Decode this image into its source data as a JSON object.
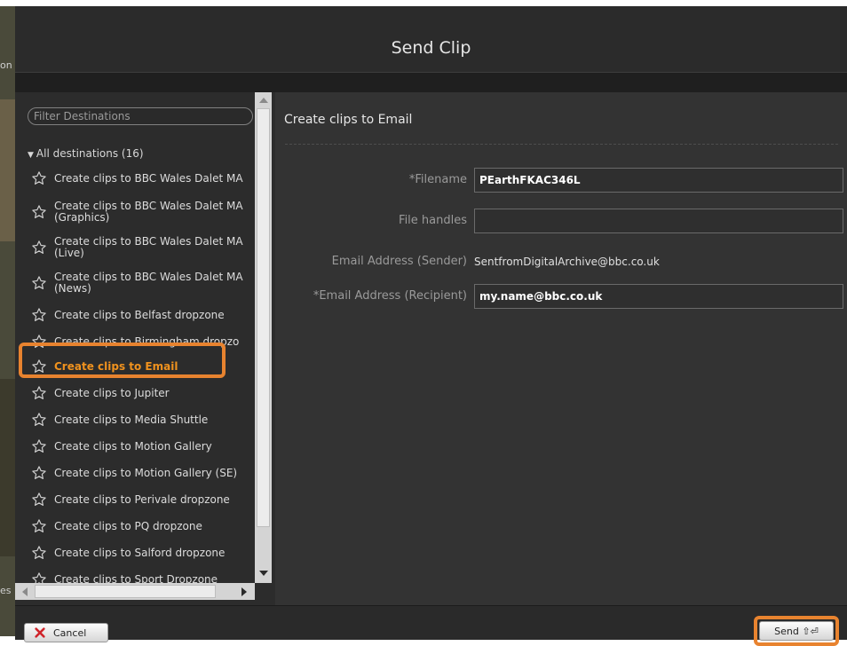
{
  "background": {
    "text_top": "on",
    "text_bottom": "es"
  },
  "dialog": {
    "title": "Send Clip"
  },
  "left_panel": {
    "filter_placeholder": "Filter Destinations",
    "tree_header": "All destinations (16)",
    "items": [
      {
        "label": "Create clips to BBC Wales Dalet MA",
        "selected": false
      },
      {
        "label": "Create clips to BBC Wales Dalet MA\n(Graphics)",
        "selected": false
      },
      {
        "label": "Create clips to BBC Wales Dalet MA\n(Live)",
        "selected": false
      },
      {
        "label": "Create clips to BBC Wales Dalet MA\n(News)",
        "selected": false
      },
      {
        "label": "Create clips to Belfast dropzone",
        "selected": false
      },
      {
        "label": "Create clips to Birmingham dropzo",
        "selected": false
      },
      {
        "label": "Create clips to Email",
        "selected": true
      },
      {
        "label": "Create clips to Jupiter",
        "selected": false
      },
      {
        "label": "Create clips to Media Shuttle",
        "selected": false
      },
      {
        "label": "Create clips to Motion Gallery",
        "selected": false
      },
      {
        "label": "Create clips to Motion Gallery (SE)",
        "selected": false
      },
      {
        "label": "Create clips to Perivale dropzone",
        "selected": false
      },
      {
        "label": "Create clips to PQ dropzone",
        "selected": false
      },
      {
        "label": "Create clips to Salford dropzone",
        "selected": false
      },
      {
        "label": "Create clips to Sport Dropzone",
        "selected": false
      }
    ]
  },
  "right_panel": {
    "section_title": "Create clips to Email",
    "fields": {
      "filename_label": "*Filename",
      "filename_value": "PEarthFKAC346L",
      "file_handles_label": "File handles",
      "file_handles_value": "",
      "sender_label": "Email Address (Sender)",
      "sender_value": "SentfromDigitalArchive@bbc.co.uk",
      "recipient_label": "*Email Address (Recipient)",
      "recipient_value": "my.name@bbc.co.uk"
    }
  },
  "footer": {
    "cancel_label": "Cancel",
    "send_label": "Send ⇧⏎"
  },
  "colors": {
    "accent": "#e8832f",
    "selected_text": "#f0921e",
    "dialog_bg": "#2c2c2c",
    "panel_bg": "#333333"
  }
}
